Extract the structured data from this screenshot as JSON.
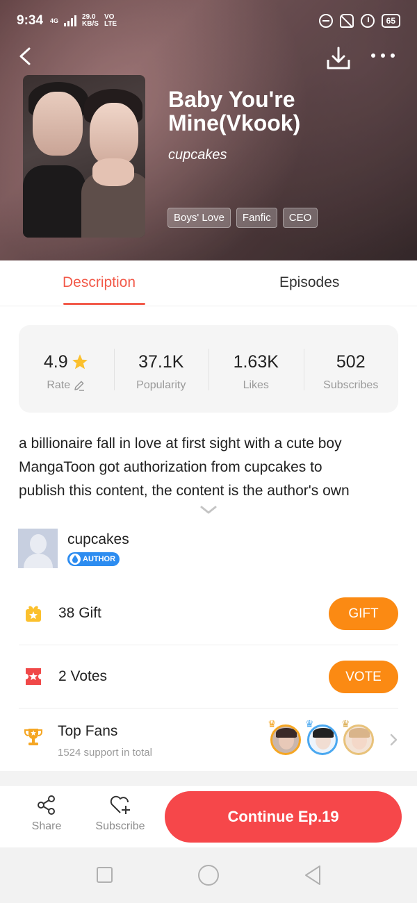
{
  "status_bar": {
    "time": "9:34",
    "network": "4G",
    "speed_value": "29.0",
    "speed_unit": "KB/S",
    "volte_top": "VO",
    "volte_bottom": "LTE",
    "battery": "65"
  },
  "header": {
    "title": "Baby You're Mine(Vkook)",
    "author": "cupcakes",
    "tags": [
      "Boys' Love",
      "Fanfic",
      "CEO"
    ]
  },
  "tabs": {
    "description": "Description",
    "episodes": "Episodes",
    "active": "Description"
  },
  "stats": {
    "rate": {
      "value": "4.9",
      "label": "Rate"
    },
    "popularity": {
      "value": "37.1K",
      "label": "Popularity"
    },
    "likes": {
      "value": "1.63K",
      "label": "Likes"
    },
    "subscribes": {
      "value": "502",
      "label": "Subscribes"
    }
  },
  "description": {
    "line1": "a billionaire fall in love at first sight with a cute boy",
    "line2": "MangaToon got authorization from cupcakes to",
    "line3": "publish this content, the content is the author's own"
  },
  "author": {
    "name": "cupcakes",
    "badge": "AUTHOR"
  },
  "gift": {
    "count_text": "38  Gift",
    "button": "GIFT"
  },
  "votes": {
    "count_text": "2  Votes",
    "button": "VOTE"
  },
  "top_fans": {
    "title": "Top Fans",
    "subtitle": "1524 support in total",
    "ring_colors": [
      "#f5a623",
      "#4aa8f0",
      "#e8c27a"
    ]
  },
  "bottom_bar": {
    "share": "Share",
    "subscribe": "Subscribe",
    "continue": "Continue Ep.19"
  },
  "colors": {
    "accent": "#f25a4a",
    "gift_button": "#fb8a13",
    "continue_button": "#f6474a",
    "author_badge": "#2c8cf0",
    "star": "#fbc02d"
  }
}
